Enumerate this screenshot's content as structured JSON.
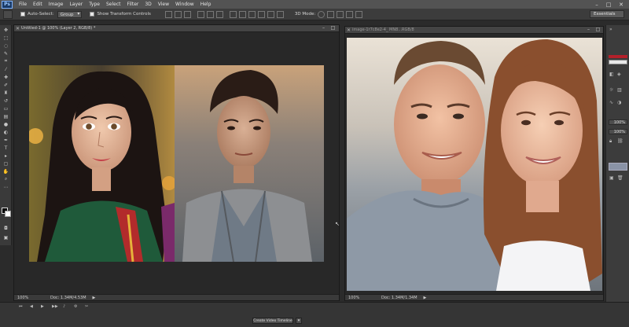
{
  "app": {
    "logo": "Ps",
    "menu": [
      "File",
      "Edit",
      "Image",
      "Layer",
      "Type",
      "Select",
      "Filter",
      "3D",
      "View",
      "Window",
      "Help"
    ]
  },
  "options_bar": {
    "auto_select_label": "Auto-Select:",
    "auto_select_value": "Group",
    "show_transform_label": "Show Transform Controls",
    "mode_label": "3D Mode:",
    "workspace": "Essentials"
  },
  "documents": [
    {
      "title": "Untitled-1 @ 100% (Layer 2, RGB/8) *",
      "zoom": "100%",
      "doc_info": "Doc: 1.34M/4.53M",
      "images": [
        {
          "description_icon": "portrait-image"
        },
        {
          "description_icon": "portrait-image"
        }
      ]
    },
    {
      "title": "image-1r7c8e2-4_ MN8...RGB/8",
      "zoom": "100%",
      "doc_info": "Doc: 1.34M/1.34M"
    }
  ],
  "right_panel": {
    "value1": "100%",
    "value2": "100%"
  },
  "timeline": {
    "create_video_label": "Create Video Timeline"
  },
  "colors": {
    "accent_red": "#b3202a",
    "chrome_dark": "#282828",
    "chrome_mid": "#3c3c3c",
    "menubar": "#535353"
  }
}
